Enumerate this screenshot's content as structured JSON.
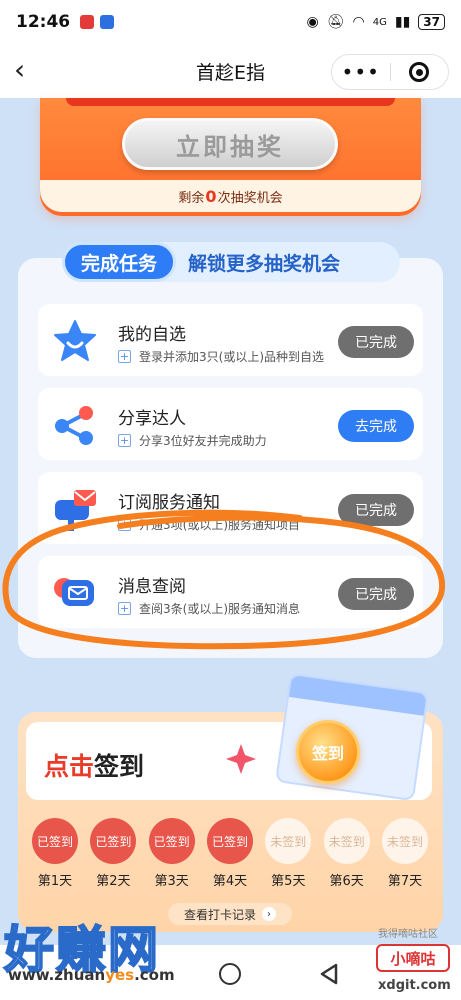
{
  "status_bar": {
    "time": "12:46",
    "network": "4G",
    "battery": "37"
  },
  "nav": {
    "title": "首趁E指"
  },
  "lottery": {
    "button_label": "立即抽奖",
    "remaining_prefix": "剩余",
    "remaining_count": "0",
    "remaining_suffix": "次抽奖机会"
  },
  "tasks": {
    "header_left": "完成任务",
    "header_right": "解锁更多抽奖机会",
    "items": [
      {
        "title": "我的自选",
        "desc": "登录并添加3只(或以上)品种到自选",
        "button": "已完成",
        "icon": "star-face-icon"
      },
      {
        "title": "分享达人",
        "desc": "分享3位好友并完成助力",
        "button": "去完成",
        "icon": "share-icon"
      },
      {
        "title": "订阅服务通知",
        "desc": "开通3项(或以上)服务通知项目",
        "button": "已完成",
        "icon": "mailbox-icon"
      },
      {
        "title": "消息查阅",
        "desc": "查阅3条(或以上)服务通知消息",
        "button": "已完成",
        "icon": "message-icon"
      }
    ]
  },
  "sign_in": {
    "title_red": "点击",
    "title_rest": "签到",
    "badge": "签到",
    "days": [
      {
        "status": "已签到",
        "label": "第1天"
      },
      {
        "status": "已签到",
        "label": "第2天"
      },
      {
        "status": "已签到",
        "label": "第3天"
      },
      {
        "status": "已签到",
        "label": "第4天"
      },
      {
        "status": "未签到",
        "label": "第5天"
      },
      {
        "status": "未签到",
        "label": "第6天"
      },
      {
        "status": "未签到",
        "label": "第7天"
      }
    ],
    "records_button": "查看打卡记录"
  },
  "watermark": {
    "logo": "好赚网",
    "url_a": "www.zhuan",
    "url_b": "yes",
    "url_c": ".com",
    "badge": "小嘀咕",
    "small": "我得嘀咕社区",
    "domain": "xdgit.com"
  },
  "colors": {
    "accent": "#2f7df5",
    "done": "#6f6f6f",
    "signed": "#e8554b",
    "orange_mark": "#f28b1b"
  }
}
